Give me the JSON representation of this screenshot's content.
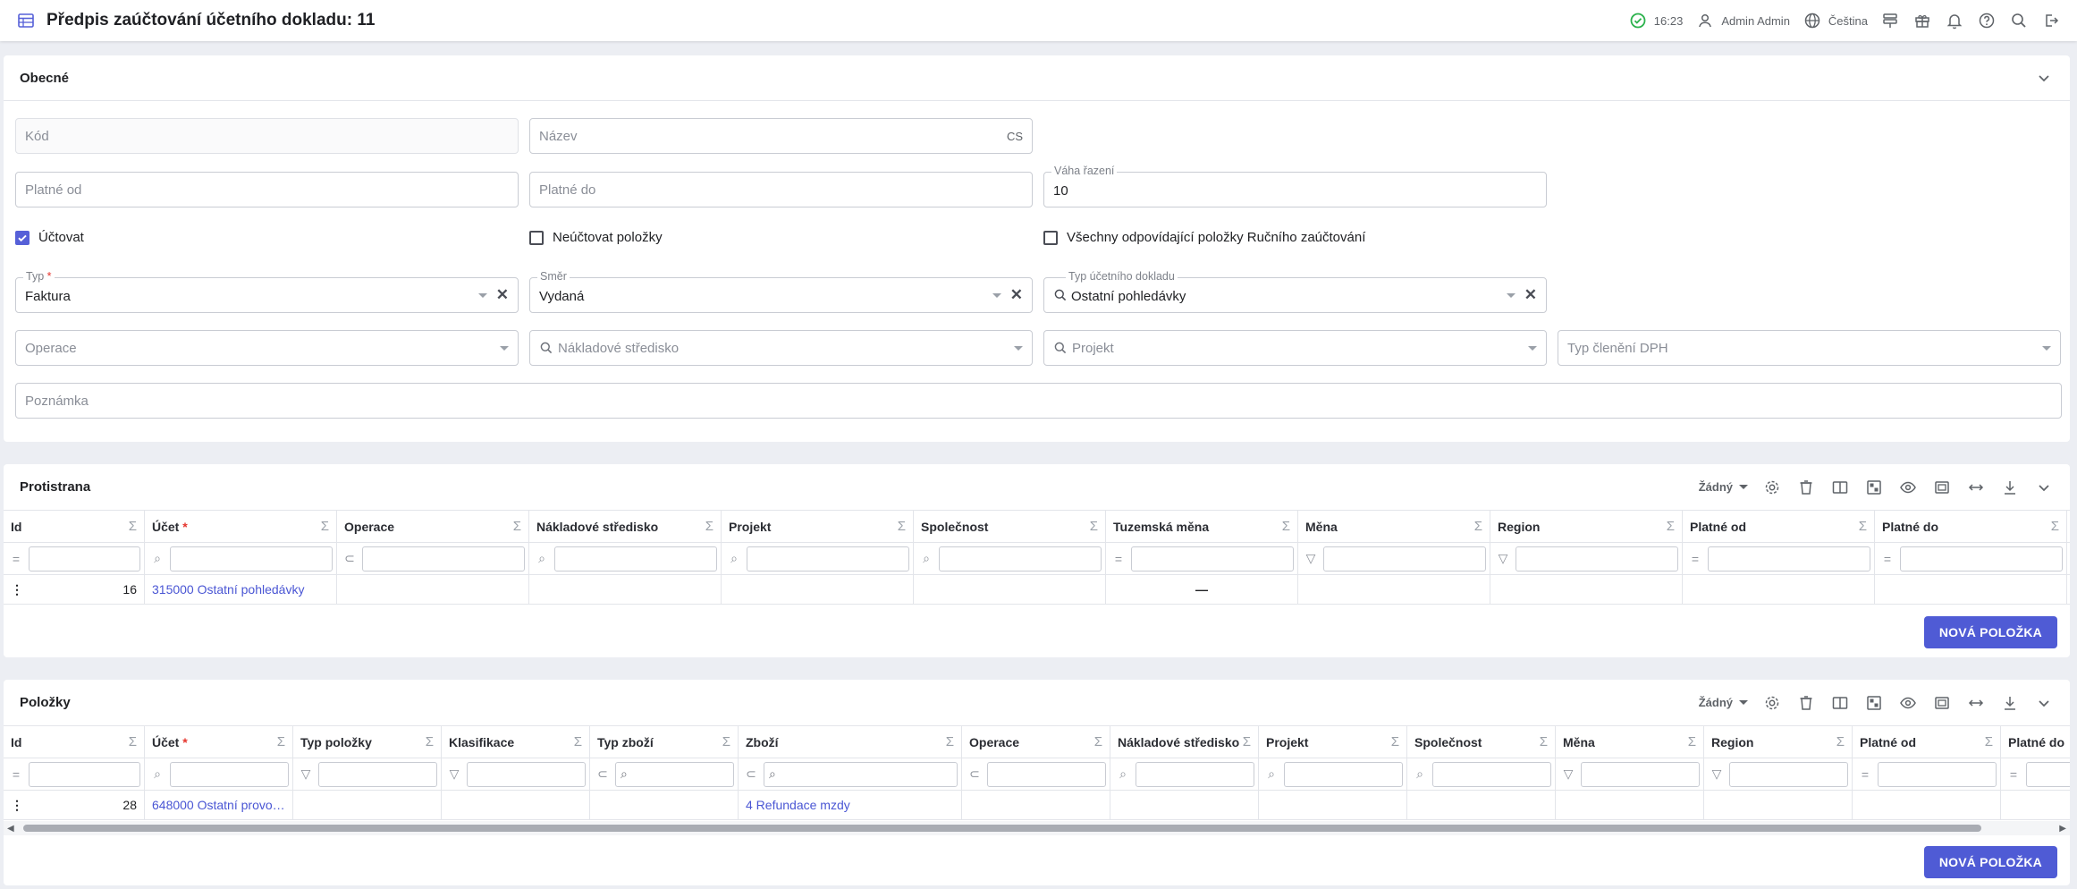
{
  "header": {
    "title": "Předpis zaúčtování účetního dokladu: 11",
    "time": "16:23",
    "user": "Admin Admin",
    "language": "Čeština"
  },
  "general": {
    "title": "Obecné",
    "kod": {
      "placeholder": "Kód"
    },
    "nazev": {
      "placeholder": "Název",
      "lang": "CS"
    },
    "platne_od": {
      "placeholder": "Platné od"
    },
    "platne_do": {
      "placeholder": "Platné do"
    },
    "vaha": {
      "label": "Váha řazení",
      "value": "10"
    },
    "uctovat": {
      "label": "Účtovat",
      "checked": true
    },
    "neuctovat": {
      "label": "Neúčtovat položky",
      "checked": false
    },
    "vsechny": {
      "label": "Všechny odpovídající položky Ručního zaúčtování",
      "checked": false
    },
    "typ": {
      "label": "Typ",
      "value": "Faktura"
    },
    "smer": {
      "label": "Směr",
      "value": "Vydaná"
    },
    "typ_dokladu": {
      "label": "Typ účetního dokladu",
      "value": "Ostatní pohledávky"
    },
    "operace": {
      "placeholder": "Operace"
    },
    "stredisko": {
      "placeholder": "Nákladové středisko"
    },
    "projekt": {
      "placeholder": "Projekt"
    },
    "typ_dph": {
      "placeholder": "Typ členění DPH"
    },
    "poznamka": {
      "placeholder": "Poznámka"
    }
  },
  "counterparty": {
    "title": "Protistrana",
    "group_select": "Žádný",
    "columns": [
      "Id",
      "Účet",
      "Operace",
      "Nákladové středisko",
      "Projekt",
      "Společnost",
      "Tuzemská měna",
      "Měna",
      "Region",
      "Platné od",
      "Platné do"
    ],
    "row": {
      "id": "16",
      "ucet": "315000 Ostatní pohledávky",
      "tuzemska": "—"
    },
    "new_button": "NOVÁ POLOŽKA"
  },
  "items": {
    "title": "Položky",
    "group_select": "Žádný",
    "columns": [
      "Id",
      "Účet",
      "Typ položky",
      "Klasifikace",
      "Typ zboží",
      "Zboží",
      "Operace",
      "Nákladové středisko",
      "Projekt",
      "Společnost",
      "Měna",
      "Region",
      "Platné od",
      "Platné do"
    ],
    "row": {
      "id": "28",
      "ucet": "648000 Ostatní provo…",
      "zbozi": "4 Refundace mzdy"
    },
    "new_button": "NOVÁ POLOŽKA"
  }
}
